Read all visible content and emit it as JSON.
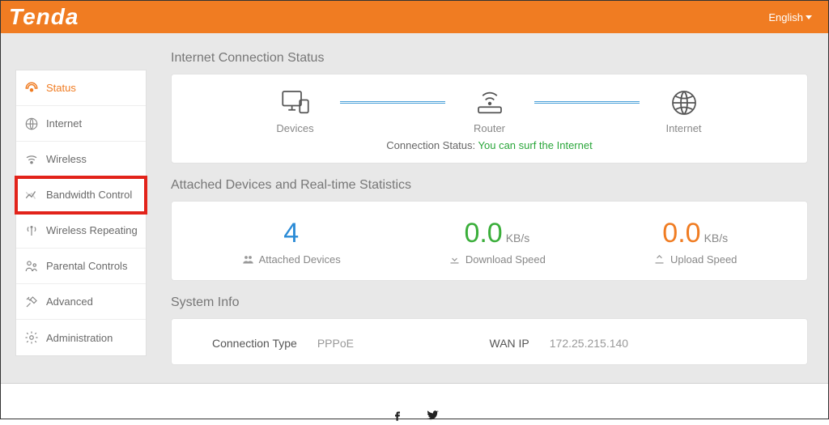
{
  "header": {
    "brand": "Tenda",
    "language_label": "English"
  },
  "sidebar": {
    "items": [
      {
        "label": "Status",
        "icon": "dashboard-icon",
        "active": true
      },
      {
        "label": "Internet",
        "icon": "globe-icon"
      },
      {
        "label": "Wireless",
        "icon": "wifi-icon"
      },
      {
        "label": "Bandwidth Control",
        "icon": "chart-icon",
        "highlight": true
      },
      {
        "label": "Wireless Repeating",
        "icon": "antenna-icon"
      },
      {
        "label": "Parental Controls",
        "icon": "family-icon"
      },
      {
        "label": "Advanced",
        "icon": "tools-icon"
      },
      {
        "label": "Administration",
        "icon": "gear-icon"
      }
    ]
  },
  "connection": {
    "section_title": "Internet Connection Status",
    "devices_label": "Devices",
    "router_label": "Router",
    "internet_label": "Internet",
    "status_prefix": "Connection Status:",
    "status_text": "You can surf the Internet"
  },
  "statistics": {
    "section_title": "Attached Devices and Real-time Statistics",
    "attached": {
      "value": "4",
      "label": "Attached Devices"
    },
    "download": {
      "value": "0.0",
      "unit": "KB/s",
      "label": "Download Speed"
    },
    "upload": {
      "value": "0.0",
      "unit": "KB/s",
      "label": "Upload Speed"
    }
  },
  "system": {
    "section_title": "System Info",
    "conn_type_label": "Connection Type",
    "conn_type_value": "PPPoE",
    "wan_ip_label": "WAN IP",
    "wan_ip_value": "172.25.215.140"
  }
}
